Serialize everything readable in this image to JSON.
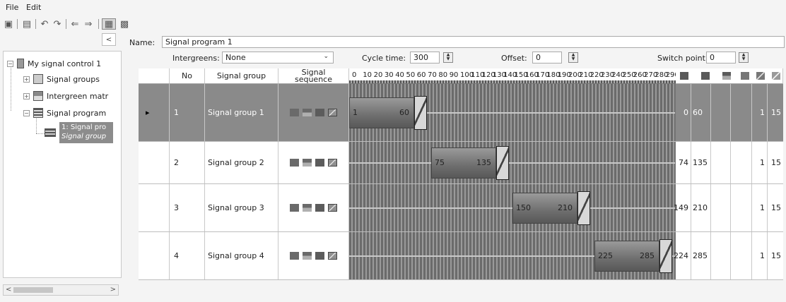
{
  "menu": {
    "file": "File",
    "edit": "Edit"
  },
  "tree": {
    "collapse_label": "<",
    "root": "My signal control 1",
    "items": [
      {
        "label": "Signal groups"
      },
      {
        "label": "Intergreen matr"
      },
      {
        "label": "Signal program"
      }
    ],
    "selected_line1": "1: Signal pro",
    "selected_line2": "Signal group"
  },
  "scroll": {
    "left": "<",
    "right": ">"
  },
  "form": {
    "name_label": "Name:",
    "name_value": "Signal program 1",
    "intergreens_label": "Intergreens:",
    "intergreens_value": "None",
    "cycle_label": "Cycle time:",
    "cycle_value": "300",
    "offset_label": "Offset:",
    "offset_value": "0",
    "switch_label": "Switch point:",
    "switch_value": "0"
  },
  "table": {
    "headers": {
      "no": "No",
      "group": "Signal group",
      "sequence_line1": "Signal",
      "sequence_line2": "sequence"
    },
    "tick_labels": [
      "0",
      "10",
      "20",
      "30",
      "40",
      "50",
      "60",
      "70",
      "80",
      "90",
      "100",
      "110",
      "120",
      "130",
      "140",
      "150",
      "160",
      "170",
      "180",
      "190",
      "200",
      "210",
      "220",
      "230",
      "240",
      "250",
      "260",
      "270",
      "280",
      "290"
    ],
    "rows": [
      {
        "no": "1",
        "name": "Signal group 1",
        "green_start": "1",
        "green_end": "60",
        "col_a": "0",
        "col_b": "60",
        "col_e": "1",
        "col_f": "15",
        "selected": true,
        "marker": "▸"
      },
      {
        "no": "2",
        "name": "Signal group 2",
        "green_start": "75",
        "green_end": "135",
        "col_a": "74",
        "col_b": "135",
        "col_e": "1",
        "col_f": "15",
        "selected": false,
        "marker": ""
      },
      {
        "no": "3",
        "name": "Signal group 3",
        "green_start": "150",
        "green_end": "210",
        "col_a": "149",
        "col_b": "210",
        "col_e": "1",
        "col_f": "15",
        "selected": false,
        "marker": ""
      },
      {
        "no": "4",
        "name": "Signal group 4",
        "green_start": "225",
        "green_end": "285",
        "col_a": "224",
        "col_b": "285",
        "col_e": "1",
        "col_f": "15",
        "selected": false,
        "marker": ""
      }
    ]
  }
}
